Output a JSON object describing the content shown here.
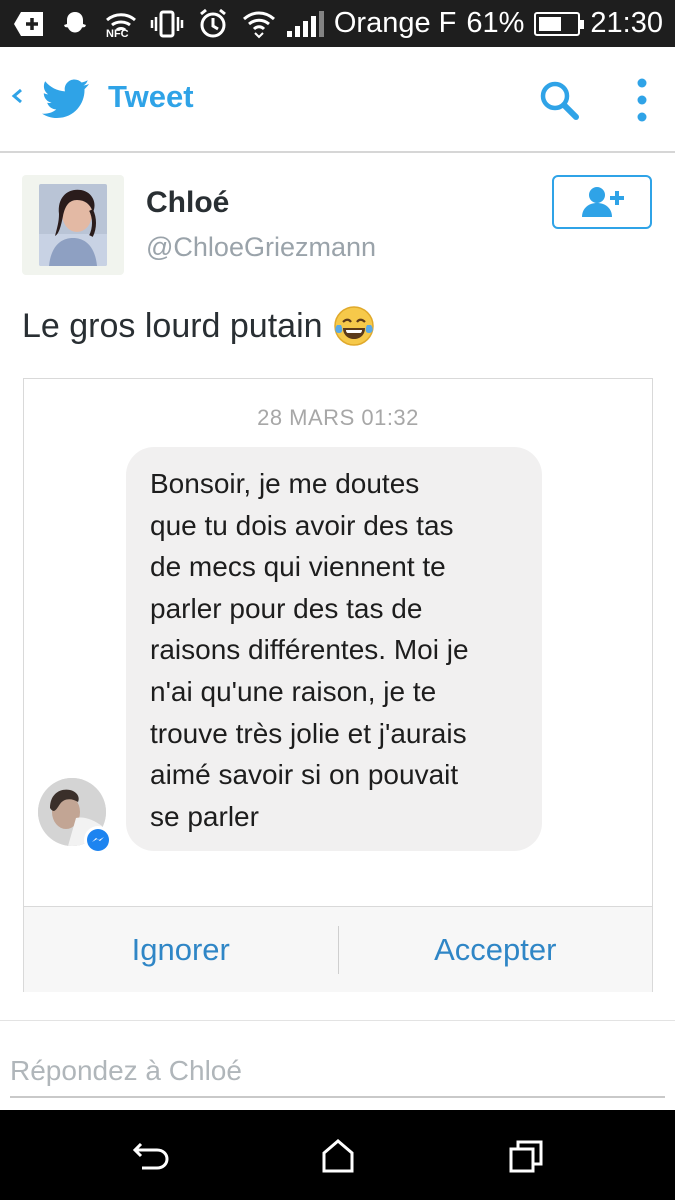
{
  "status_bar": {
    "carrier": "Orange F",
    "battery_percent": "61%",
    "battery_level": 0.61,
    "time": "21:30",
    "nfc_label": "NFC"
  },
  "header": {
    "title": "Tweet"
  },
  "tweet": {
    "author_name": "Chloé",
    "author_handle": "@ChloeGriezmann",
    "text": "Le gros lourd putain",
    "emoji": "face-with-tears-of-joy"
  },
  "card": {
    "date": "28 MARS 01:32",
    "message_lines": [
      "Bonsoir, je me doutes",
      "que tu dois avoir des tas",
      "de mecs qui viennent te",
      "parler pour des tas de",
      "raisons différentes. Moi je",
      "n'ai qu'une raison, je te",
      "trouve très jolie et j'aurais",
      "aimé savoir si on pouvait",
      "se parler"
    ],
    "ignore_label": "Ignorer",
    "accept_label": "Accepter"
  },
  "reply": {
    "placeholder": "Répondez à Chloé"
  },
  "colors": {
    "twitter_blue": "#2fa3e7",
    "messenger_blue": "#2f86c6",
    "bubble_gray": "#f1f0f0",
    "status_bar_bg": "#1e1e1e"
  }
}
